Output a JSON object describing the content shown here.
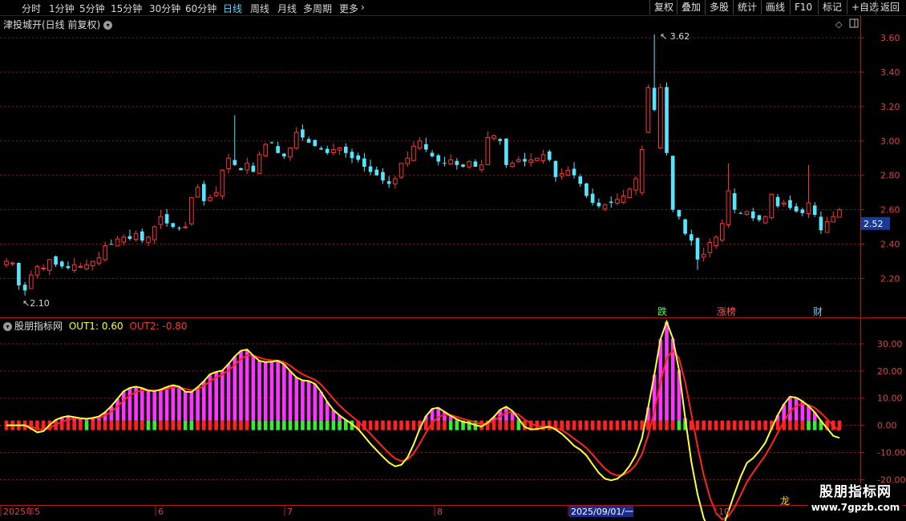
{
  "toolbar": {
    "periods": [
      "分时",
      "1分钟",
      "5分钟",
      "15分钟",
      "30分钟",
      "60分钟",
      "日线",
      "周线",
      "月线",
      "多周期",
      "更多"
    ],
    "active_period": "日线",
    "right_buttons": [
      "复权",
      "叠加",
      "多股",
      "统计",
      "画线",
      "F10",
      "标记",
      "+自选",
      "返回"
    ]
  },
  "chart": {
    "title": "津投城开(日线 前复权)",
    "current_price": "2.52",
    "high_label": "3.62",
    "low_label": "2.10",
    "event_markers": [
      {
        "text": "跌",
        "color": "#44ff44"
      },
      {
        "text": "涨榜",
        "color": "#ff5555"
      },
      {
        "text": "财",
        "color": "#5fd4ff"
      }
    ]
  },
  "indicator": {
    "name": "股朋指标网",
    "out1_label": "OUT1: 0.60",
    "out2_label": "OUT2: -0.80"
  },
  "colors": {
    "up": "#ff3333",
    "down": "#55e6ff",
    "grid": "#8b1a1a",
    "hist_pos": "#ff33ff",
    "hist_pos_base": "#ff2222",
    "hist_neg": "#33ee33",
    "line_fast": "#ffff33",
    "line_slow": "#ff2222"
  },
  "date_axis": {
    "labels": [
      "2025年5",
      "6",
      "7",
      "8",
      "2025/09/01/一",
      "10"
    ]
  },
  "watermark": {
    "cn": "股朋指标网",
    "url": "www.7gpzb.com",
    "mark": "龙"
  },
  "chart_data": {
    "type": "candlestick",
    "price_axis": {
      "ticks": [
        2.2,
        2.4,
        2.6,
        2.8,
        3.0,
        3.2,
        3.4,
        3.6
      ],
      "ylim": [
        2.02,
        3.68
      ]
    },
    "indicator_axis": {
      "ticks": [
        30,
        20,
        10,
        0,
        -10,
        -20
      ],
      "ylim": [
        -24,
        35
      ]
    },
    "close": [
      2.3,
      2.29,
      2.16,
      2.13,
      2.22,
      2.27,
      2.26,
      2.31,
      2.28,
      2.27,
      2.26,
      2.28,
      2.27,
      2.28,
      2.3,
      2.32,
      2.39,
      2.4,
      2.43,
      2.44,
      2.43,
      2.46,
      2.42,
      2.44,
      2.5,
      2.56,
      2.52,
      2.5,
      2.49,
      2.5,
      2.67,
      2.73,
      2.65,
      2.67,
      2.7,
      2.83,
      2.9,
      2.86,
      2.83,
      2.87,
      2.82,
      2.92,
      2.98,
      2.99,
      2.93,
      2.91,
      2.96,
      3.05,
      3.02,
      2.99,
      2.97,
      2.95,
      2.93,
      2.95,
      2.96,
      2.93,
      2.9,
      2.89,
      2.85,
      2.82,
      2.8,
      2.77,
      2.75,
      2.78,
      2.87,
      2.9,
      2.97,
      3.0,
      2.95,
      2.91,
      2.88,
      2.87,
      2.89,
      2.86,
      2.85,
      2.88,
      2.85,
      2.86,
      3.02,
      3.03,
      3.0,
      2.86,
      2.87,
      2.89,
      2.88,
      2.89,
      2.9,
      2.92,
      2.89,
      2.79,
      2.81,
      2.83,
      2.8,
      2.75,
      2.68,
      2.64,
      2.62,
      2.63,
      2.64,
      2.66,
      2.68,
      2.72,
      2.78,
      2.95,
      3.31,
      3.18,
      3.31,
      2.93,
      2.6,
      2.56,
      2.46,
      2.42,
      2.31,
      2.34,
      2.41,
      2.44,
      2.52,
      2.71,
      2.6,
      2.58,
      2.59,
      2.55,
      2.54,
      2.56,
      2.69,
      2.62,
      2.64,
      2.61,
      2.59,
      2.58,
      2.64,
      2.57,
      2.48,
      2.53,
      2.56,
      2.6
    ]
  }
}
